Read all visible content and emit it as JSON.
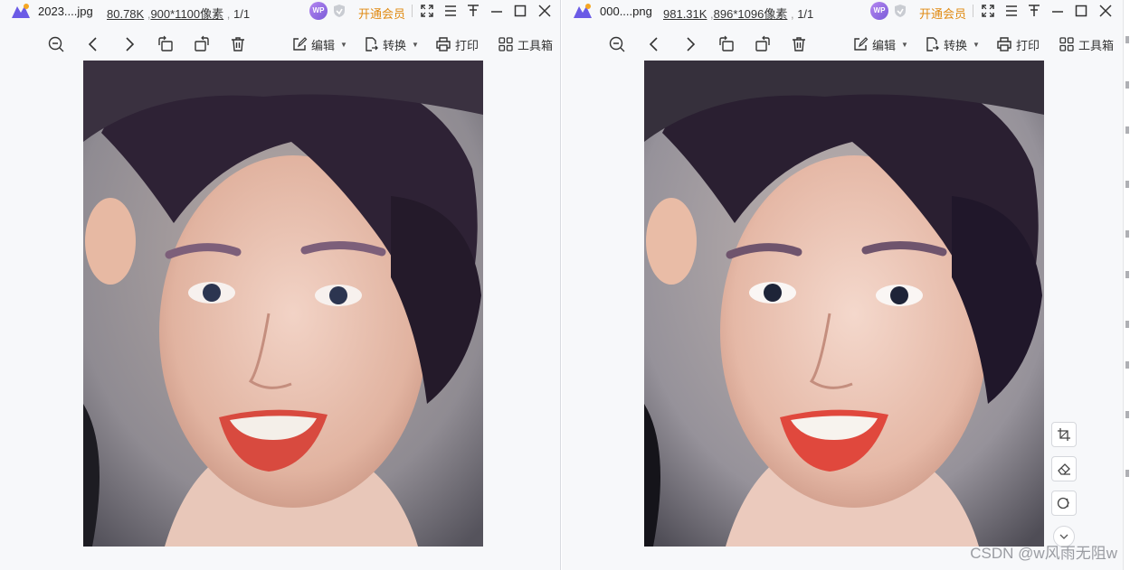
{
  "viewers": [
    {
      "file_name": "2023....jpg",
      "file_size": "80.78K",
      "dimensions": "900*1100像素",
      "page_indicator": "1/1",
      "badge": "WP",
      "vip_label": "开通会员",
      "toolbar": {
        "edit": "编辑",
        "convert": "转换",
        "print": "打印",
        "tools": "工具箱"
      }
    },
    {
      "file_name": "000....png",
      "file_size": "981.31K",
      "dimensions": "896*1096像素",
      "page_indicator": "1/1",
      "badge": "WP",
      "vip_label": "开通会员",
      "toolbar": {
        "edit": "编辑",
        "convert": "转换",
        "print": "打印",
        "tools": "工具箱"
      }
    }
  ],
  "icons": [
    "app-logo-icon",
    "shield-icon",
    "fullscreen-icon",
    "menu-icon",
    "pin-icon",
    "minimize-icon",
    "maximize-icon",
    "close-icon",
    "zoom-out-icon",
    "previous-icon",
    "next-icon",
    "rotate-left-icon",
    "rotate-right-icon",
    "delete-icon",
    "edit-icon",
    "convert-icon",
    "print-icon",
    "toolbox-icon",
    "crop-icon",
    "eraser-icon",
    "cutout-icon",
    "chevron-down-icon"
  ],
  "colors": {
    "vip": "#e08a12",
    "badge": "#8e6ae0",
    "background": "#f7f8fa"
  },
  "watermark": "CSDN @w风雨无阻w"
}
